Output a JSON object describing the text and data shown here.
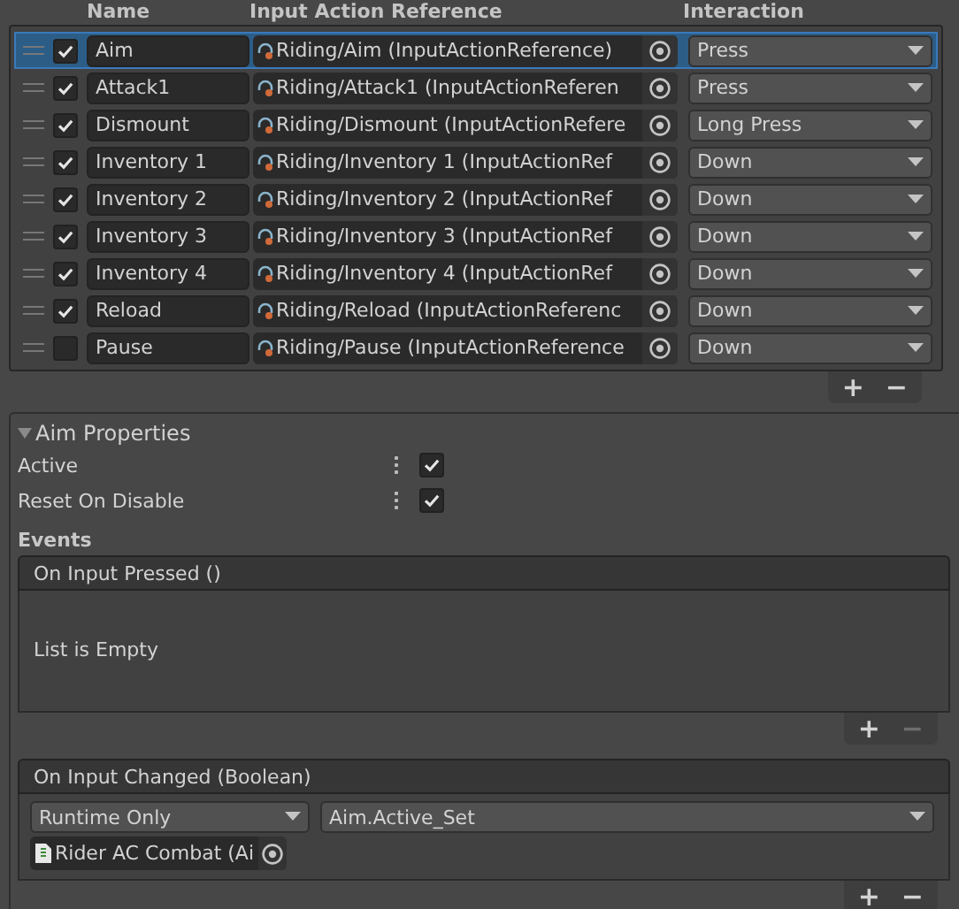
{
  "columns": [
    "Name",
    "Input Action Reference",
    "Interaction"
  ],
  "rows": [
    {
      "enabled": true,
      "name": "Aim",
      "reference": "Riding/Aim (InputActionReference)",
      "interaction": "Press",
      "selected": true
    },
    {
      "enabled": true,
      "name": "Attack1",
      "reference": "Riding/Attack1 (InputActionReferen",
      "interaction": "Press",
      "selected": false
    },
    {
      "enabled": true,
      "name": "Dismount",
      "reference": "Riding/Dismount (InputActionRefere",
      "interaction": "Long Press",
      "selected": false
    },
    {
      "enabled": true,
      "name": "Inventory 1",
      "reference": "Riding/Inventory 1 (InputActionRef",
      "interaction": "Down",
      "selected": false
    },
    {
      "enabled": true,
      "name": "Inventory 2",
      "reference": "Riding/Inventory 2 (InputActionRef",
      "interaction": "Down",
      "selected": false
    },
    {
      "enabled": true,
      "name": "Inventory 3",
      "reference": "Riding/Inventory 3 (InputActionRef",
      "interaction": "Down",
      "selected": false
    },
    {
      "enabled": true,
      "name": "Inventory 4",
      "reference": "Riding/Inventory 4 (InputActionRef",
      "interaction": "Down",
      "selected": false
    },
    {
      "enabled": true,
      "name": "Reload",
      "reference": "Riding/Reload (InputActionReferenc",
      "interaction": "Down",
      "selected": false
    },
    {
      "enabled": false,
      "name": "Pause",
      "reference": "Riding/Pause (InputActionReference",
      "interaction": "Down",
      "selected": false
    }
  ],
  "list_footer": {
    "add": "+",
    "remove": "−",
    "remove_disabled": false
  },
  "properties": {
    "title": "Aim Properties",
    "expanded": true,
    "fields": [
      {
        "label": "Active",
        "checked": true
      },
      {
        "label": "Reset On Disable",
        "checked": true
      }
    ]
  },
  "events": {
    "title": "Events",
    "items": [
      {
        "title": "On Input Pressed ()",
        "empty_text": "List is Empty",
        "add": "+",
        "remove": "−",
        "remove_disabled": true
      },
      {
        "title": "On Input Changed (Boolean)",
        "add": "+",
        "remove": "−",
        "remove_disabled": false,
        "listeners": [
          {
            "mode": "Runtime Only",
            "function": "Aim.Active_Set",
            "target": "Rider AC Combat (Ai"
          }
        ]
      }
    ]
  }
}
